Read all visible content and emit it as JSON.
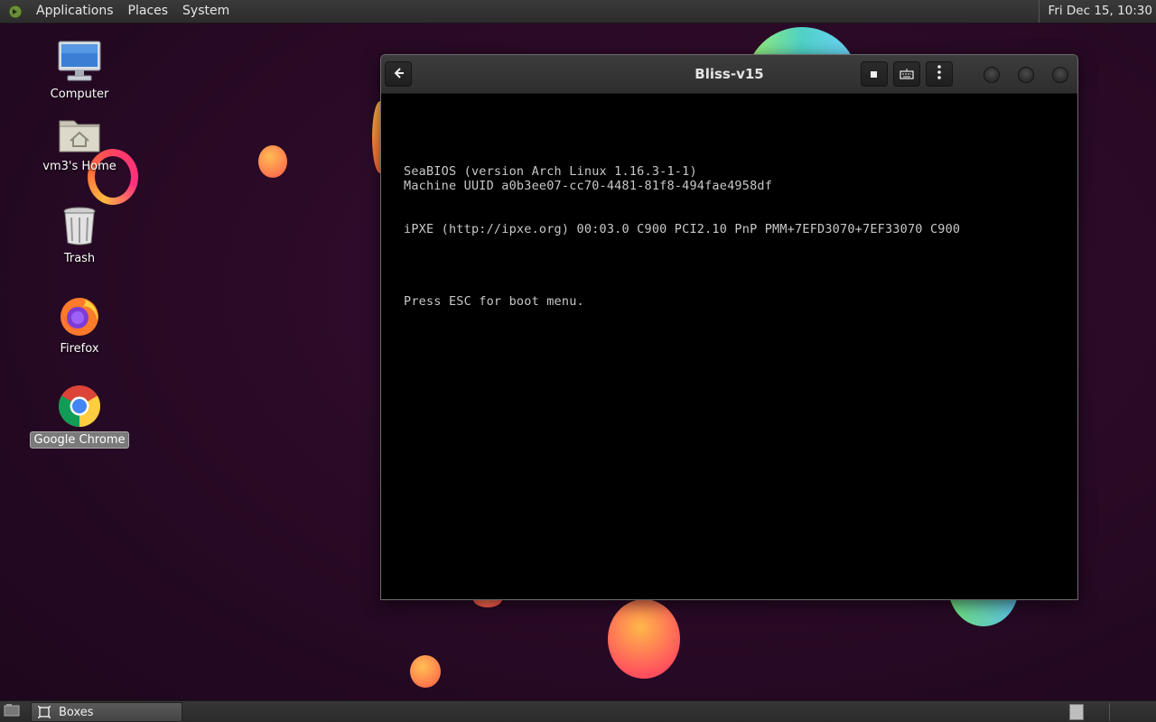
{
  "top_panel": {
    "menus": [
      "Applications",
      "Places",
      "System"
    ],
    "clock": "Fri Dec 15, 10:30"
  },
  "desktop": {
    "icons": [
      {
        "label": "Computer",
        "icon": "computer-icon"
      },
      {
        "label": "vm3's Home",
        "icon": "home-folder-icon"
      },
      {
        "label": "Trash",
        "icon": "trash-icon"
      },
      {
        "label": "Firefox",
        "icon": "firefox-icon"
      },
      {
        "label": "Google Chrome",
        "icon": "chrome-icon",
        "selected": true
      }
    ]
  },
  "window": {
    "title": "Bliss-v15",
    "buttons": [
      "back-icon",
      "stop-icon",
      "keyboard-icon",
      "more-icon"
    ],
    "console_lines": [
      "SeaBIOS (version Arch Linux 1.16.3-1-1)",
      "Machine UUID a0b3ee07-cc70-4481-81f8-494fae4958df",
      "iPXE (http://ipxe.org) 00:03.0 C900 PCI2.10 PnP PMM+7EFD3070+7EF33070 C900",
      "Press ESC for boot menu."
    ]
  },
  "bottom_panel": {
    "tasks": [
      {
        "label": "Boxes",
        "icon": "boxes-icon"
      }
    ]
  },
  "colors": {
    "desktop_bg": "#2a0a27",
    "panel_bg": "#2e2e2e",
    "console_text": "#c8c8c8"
  }
}
